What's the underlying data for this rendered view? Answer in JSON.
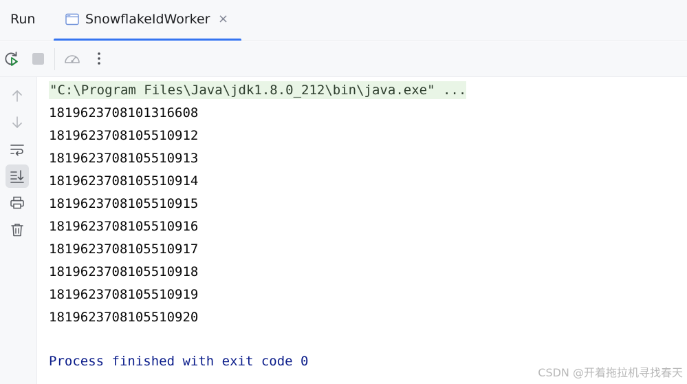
{
  "header": {
    "title": "Run",
    "tab": {
      "label": "SnowflakeIdWorker",
      "close_glyph": "×",
      "icon": "console-window-icon"
    }
  },
  "toolbar": {
    "buttons": [
      "rerun-icon",
      "stop-icon",
      "profiler-icon",
      "more-icon"
    ]
  },
  "gutter": {
    "buttons": [
      "arrow-up-icon",
      "arrow-down-icon",
      "soft-wrap-icon",
      "scroll-to-end-icon",
      "print-icon",
      "trash-icon"
    ],
    "active": "scroll-to-end-icon"
  },
  "console": {
    "command": "\"C:\\Program Files\\Java\\jdk1.8.0_212\\bin\\java.exe\" ...",
    "lines": [
      "1819623708101316608",
      "1819623708105510912",
      "1819623708105510913",
      "1819623708105510914",
      "1819623708105510915",
      "1819623708105510916",
      "1819623708105510917",
      "1819623708105510918",
      "1819623708105510919",
      "1819623708105510920"
    ],
    "exit_message": "Process finished with exit code 0"
  },
  "watermark": "CSDN @开着拖拉机寻找春天",
  "colors": {
    "accent": "#3574f0",
    "command_bg": "#e9f5e6",
    "exit_text": "#0a1c8a",
    "rerun_green": "#208a3c"
  }
}
